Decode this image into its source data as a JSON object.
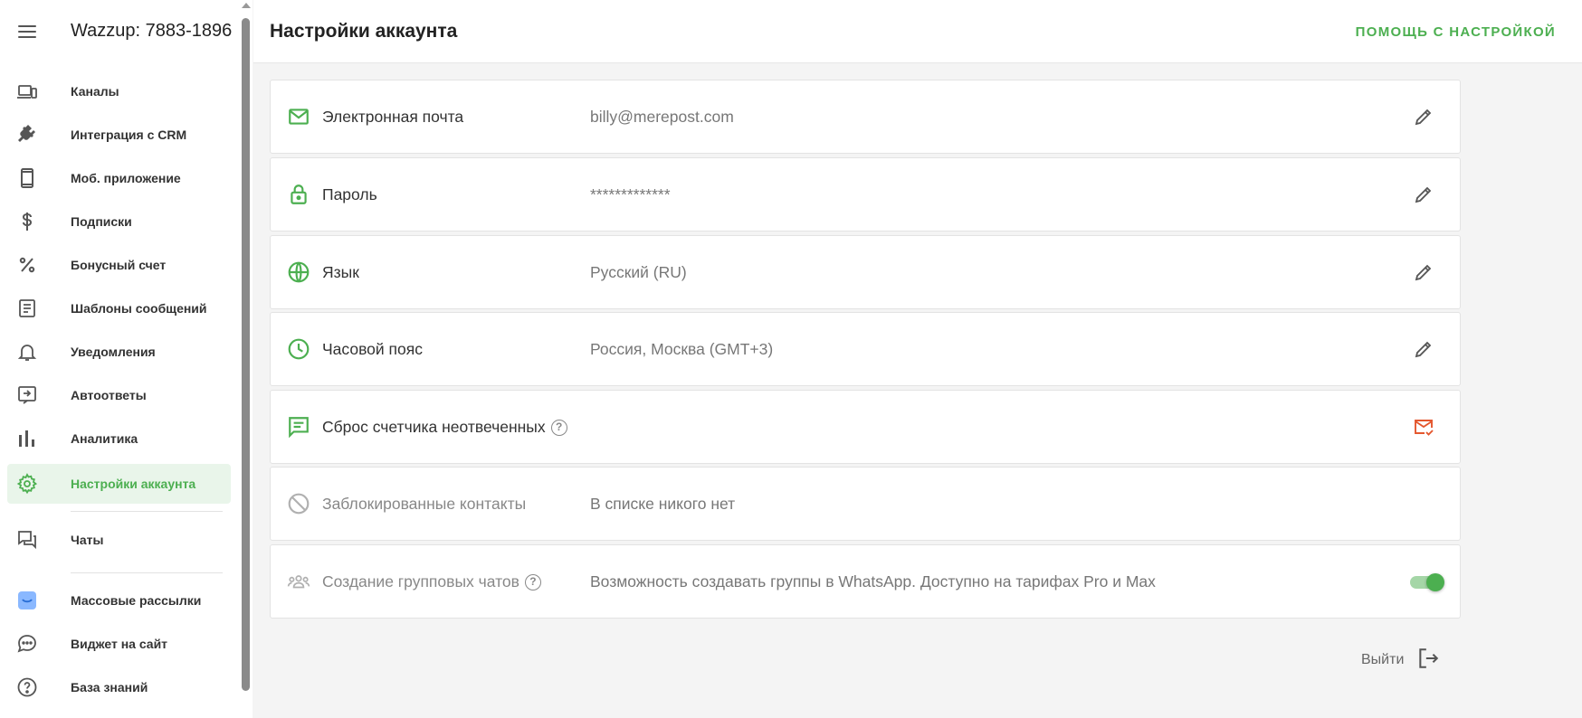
{
  "sidebar": {
    "account_title": "Wazzup: 7883-1896",
    "items": [
      {
        "label": "Каналы",
        "icon": "devices-icon"
      },
      {
        "label": "Интеграция с CRM",
        "icon": "plug-icon"
      },
      {
        "label": "Моб. приложение",
        "icon": "phone-icon"
      },
      {
        "label": "Подписки",
        "icon": "dollar-icon"
      },
      {
        "label": "Бонусный счет",
        "icon": "percent-icon"
      },
      {
        "label": "Шаблоны сообщений",
        "icon": "template-icon"
      },
      {
        "label": "Уведомления",
        "icon": "bell-icon"
      },
      {
        "label": "Автоответы",
        "icon": "autoreply-icon"
      },
      {
        "label": "Аналитика",
        "icon": "bar-chart-icon"
      },
      {
        "label": "Настройки аккаунта",
        "icon": "gear-icon",
        "active": true
      },
      {
        "label": "Чаты",
        "icon": "chats-icon"
      },
      {
        "label": "Массовые рассылки",
        "icon": "broadcast-icon"
      },
      {
        "label": "Виджет на сайт",
        "icon": "widget-icon"
      },
      {
        "label": "База знаний",
        "icon": "help-circle-icon"
      }
    ]
  },
  "header": {
    "title": "Настройки аккаунта",
    "help_label": "ПОМОЩЬ С НАСТРОЙКОЙ"
  },
  "settings": {
    "email": {
      "label": "Электронная почта",
      "value": "billy@merepost.com"
    },
    "password": {
      "label": "Пароль",
      "value": "*************"
    },
    "language": {
      "label": "Язык",
      "value": "Русский (RU)"
    },
    "timezone": {
      "label": "Часовой пояс",
      "value": "Россия, Москва (GMT+3)"
    },
    "unanswered": {
      "label": "Сброс счетчика неотвеченных",
      "help": "?"
    },
    "blocked": {
      "label": "Заблокированные контакты",
      "value": "В списке никого нет"
    },
    "groups": {
      "label": "Создание групповых чатов",
      "help": "?",
      "value": "Возможность создавать группы в WhatsApp. Доступно на тарифах Pro и Max",
      "enabled": true
    }
  },
  "logout": {
    "label": "Выйти"
  },
  "colors": {
    "accent": "#4caf50",
    "alert": "#e4572e",
    "muted": "#9e9e9e"
  }
}
